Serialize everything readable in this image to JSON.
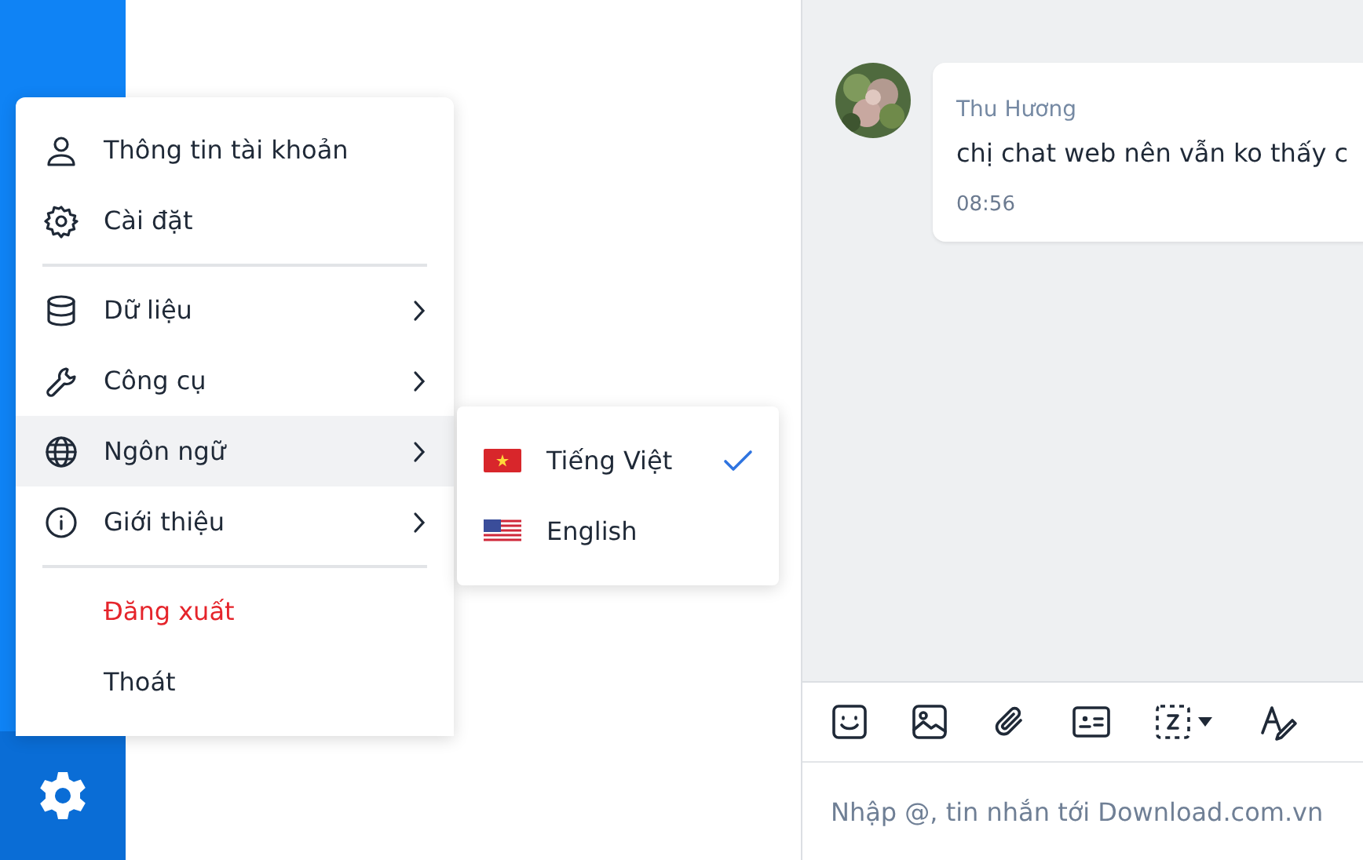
{
  "menu": {
    "sections": [
      [
        {
          "label": "Thông tin tài khoản",
          "kind": "icon",
          "has_submenu": false,
          "selected": false,
          "danger": false
        },
        {
          "label": "Cài đặt",
          "kind": "icon",
          "has_submenu": false,
          "selected": false,
          "danger": false
        }
      ],
      [
        {
          "label": "Dữ liệu",
          "kind": "icon",
          "has_submenu": true,
          "selected": false,
          "danger": false
        },
        {
          "label": "Công cụ",
          "kind": "icon",
          "has_submenu": true,
          "selected": false,
          "danger": false
        },
        {
          "label": "Ngôn ngữ",
          "kind": "icon",
          "has_submenu": true,
          "selected": true,
          "danger": false
        },
        {
          "label": "Giới thiệu",
          "kind": "icon",
          "has_submenu": true,
          "selected": false,
          "danger": false
        }
      ],
      [
        {
          "label": "Đăng xuất",
          "kind": "text",
          "has_submenu": false,
          "selected": false,
          "danger": true
        },
        {
          "label": "Thoát",
          "kind": "text",
          "has_submenu": false,
          "selected": false,
          "danger": false
        }
      ]
    ]
  },
  "language_submenu": [
    {
      "label": "Tiếng Việt",
      "selected": true
    },
    {
      "label": "English",
      "selected": false
    }
  ],
  "chat": {
    "messages": [
      {
        "sender": "Thu Hương",
        "text": "chị chat web nên vẫn ko thấy c",
        "time": "08:56"
      }
    ],
    "composer": {
      "placeholder": "Nhập @, tin nhắn tới Download.com.vn"
    }
  }
}
